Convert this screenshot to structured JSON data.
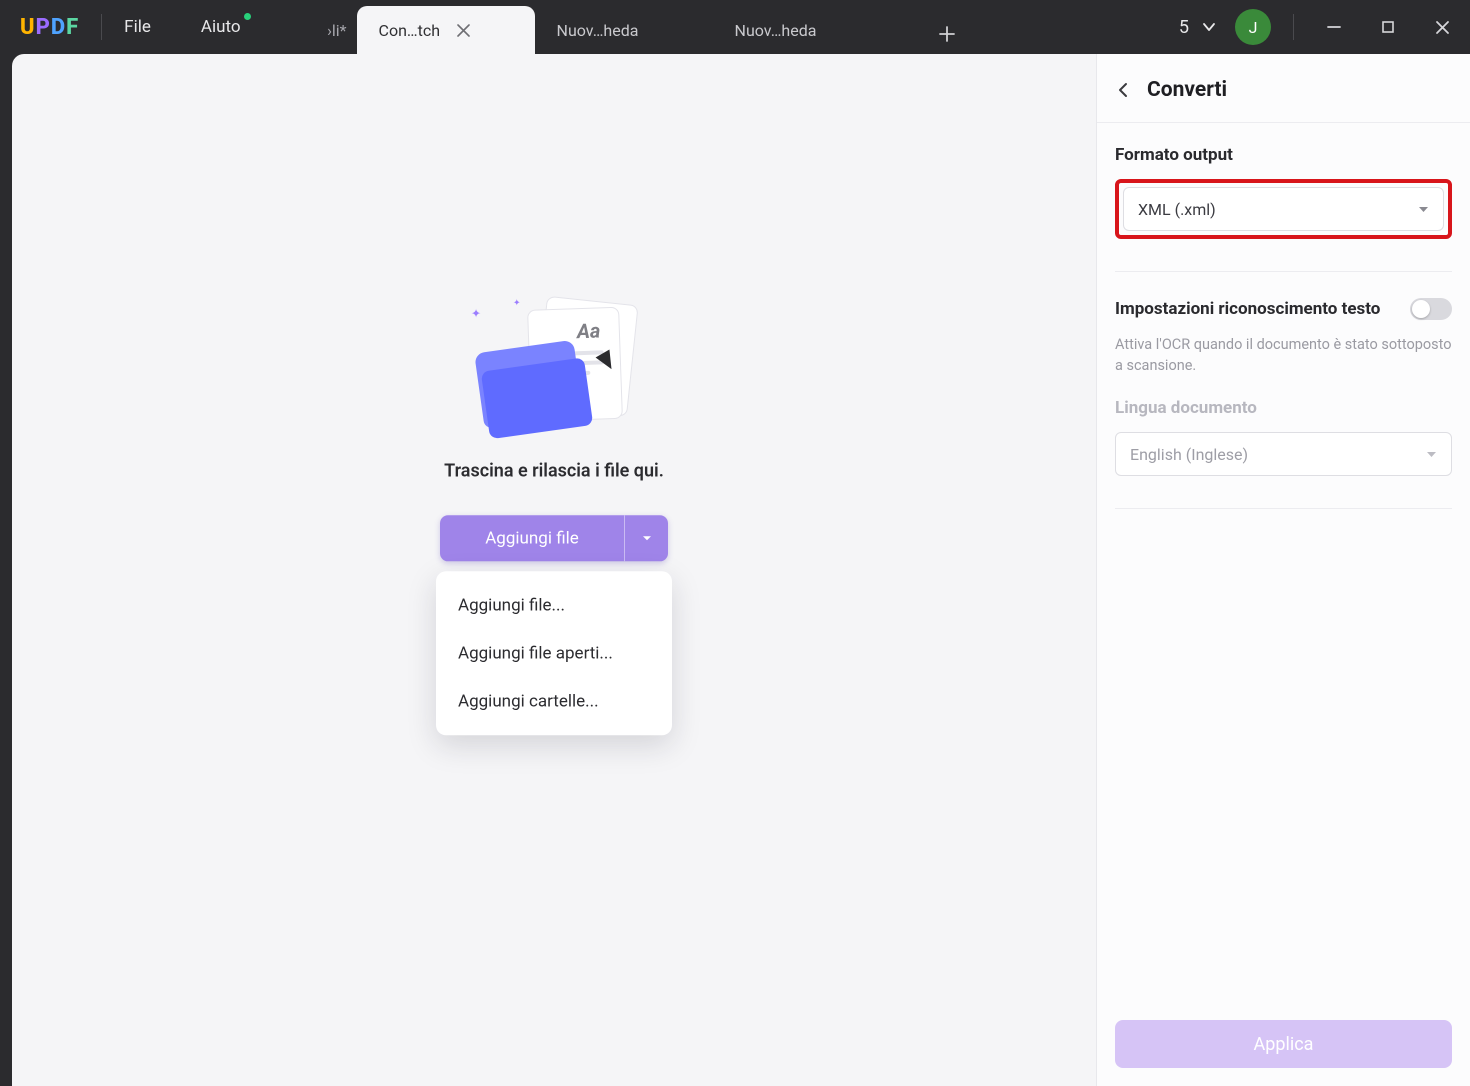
{
  "app": {
    "logo_letters": [
      "U",
      "P",
      "D",
      "F"
    ]
  },
  "menus": {
    "file": "File",
    "help": "Aiuto"
  },
  "tabs": {
    "bg_partial": "›li*",
    "items": [
      {
        "label": "Con…tch",
        "active": true,
        "closable": true
      },
      {
        "label": "Nuov…heda",
        "active": false,
        "closable": false
      },
      {
        "label": "Nuov…heda",
        "active": false,
        "closable": false
      }
    ]
  },
  "top_right": {
    "count": "5",
    "avatar_initial": "J"
  },
  "drop": {
    "text": "Trascina e rilascia i file qui.",
    "button": "Aggiungi file",
    "menu": [
      "Aggiungi file...",
      "Aggiungi file aperti...",
      "Aggiungi cartelle..."
    ],
    "illus_aa": "Aa"
  },
  "panel": {
    "title": "Converti",
    "format_label": "Formato output",
    "format_value": "XML (.xml)",
    "ocr_label": "Impostazioni riconoscimento testo",
    "ocr_hint": "Attiva l'OCR quando il documento è stato sottoposto a scansione.",
    "lang_label": "Lingua documento",
    "lang_value": "English (Inglese)",
    "apply": "Applica"
  }
}
